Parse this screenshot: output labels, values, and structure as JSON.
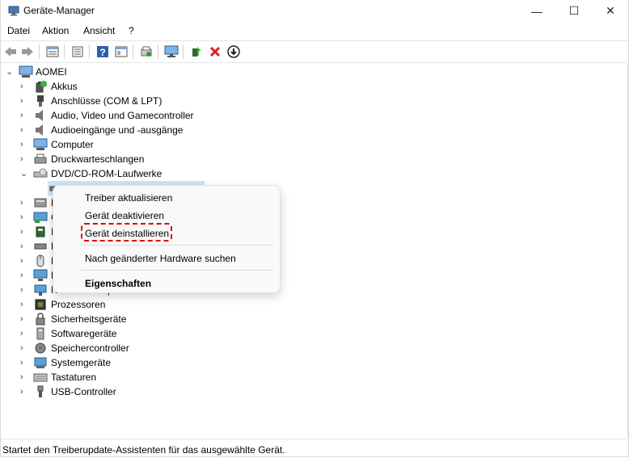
{
  "window": {
    "title": "Geräte-Manager",
    "min_label": "—",
    "max_label": "☐",
    "close_label": "✕"
  },
  "menubar": {
    "items": [
      "Datei",
      "Aktion",
      "Ansicht",
      "?"
    ]
  },
  "toolbar": {
    "icons": [
      "back-icon",
      "forward-icon",
      "properties-icon",
      "list-view-icon",
      "help-icon",
      "view-icon",
      "scan-icon",
      "monitor-icon",
      "update-driver-icon",
      "uninstall-icon",
      "disable-icon"
    ]
  },
  "tree": {
    "root": "AOMEI",
    "items": [
      {
        "label": "Akkus",
        "icon": "battery-icon"
      },
      {
        "label": "Anschlüsse (COM & LPT)",
        "icon": "port-icon"
      },
      {
        "label": "Audio, Video und Gamecontroller",
        "icon": "speaker-icon"
      },
      {
        "label": "Audioeingänge und -ausgänge",
        "icon": "speaker-icon"
      },
      {
        "label": "Computer",
        "icon": "computer-icon"
      },
      {
        "label": "Druckwarteschlangen",
        "icon": "printer-icon"
      },
      {
        "label": "DVD/CD-ROM-Laufwerke",
        "icon": "dvd-drive-icon"
      },
      {
        "label": "",
        "icon": "dvd-device-icon"
      },
      {
        "label": "E",
        "icon": "hid-icon"
      },
      {
        "label": "G",
        "icon": "display-adapter-icon"
      },
      {
        "label": "I",
        "icon": "chip-icon"
      },
      {
        "label": "L",
        "icon": "drive-icon"
      },
      {
        "label": "M",
        "icon": "mouse-icon"
      },
      {
        "label": "M",
        "icon": "monitor-icon"
      },
      {
        "label": "Netzwerkadapter",
        "icon": "network-icon"
      },
      {
        "label": "Prozessoren",
        "icon": "processor-icon"
      },
      {
        "label": "Sicherheitsgeräte",
        "icon": "security-icon"
      },
      {
        "label": "Softwaregeräte",
        "icon": "software-device-icon"
      },
      {
        "label": "Speichercontroller",
        "icon": "storage-controller-icon"
      },
      {
        "label": "Systemgeräte",
        "icon": "system-device-icon"
      },
      {
        "label": "Tastaturen",
        "icon": "keyboard-icon"
      },
      {
        "label": "USB-Controller",
        "icon": "usb-icon"
      }
    ]
  },
  "context_menu": {
    "update_driver": "Treiber aktualisieren",
    "disable_device": "Gerät deaktivieren",
    "uninstall_device": "Gerät deinstallieren",
    "scan_hardware": "Nach geänderter Hardware suchen",
    "properties": "Eigenschaften"
  },
  "status": {
    "text": "Startet den Treiberupdate-Assistenten für das ausgewählte Gerät."
  },
  "colors": {
    "accent": "#0067c0",
    "highlight": "#d90000",
    "selection": "#cce4f7"
  }
}
